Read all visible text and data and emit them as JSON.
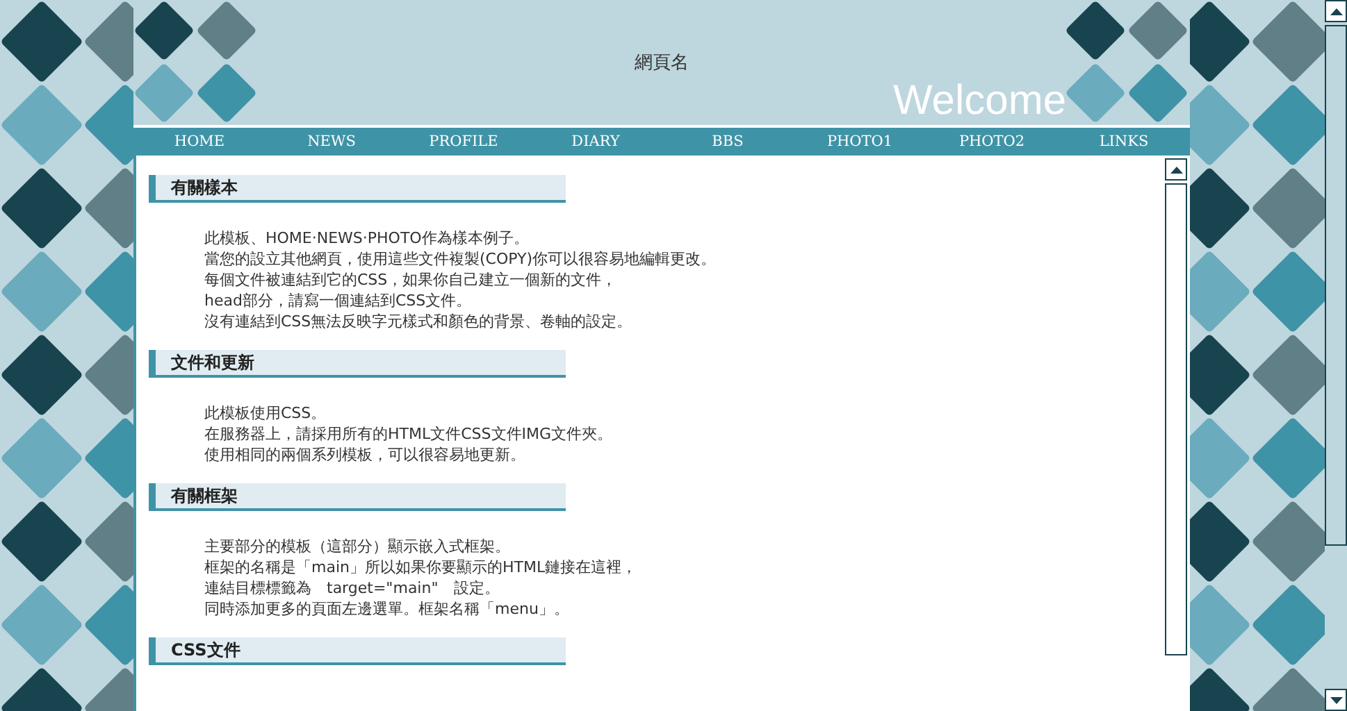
{
  "header": {
    "title": "網頁名",
    "welcome": "Welcome"
  },
  "nav": [
    {
      "label": "HOME"
    },
    {
      "label": "NEWS"
    },
    {
      "label": "PROFILE"
    },
    {
      "label": "DIARY"
    },
    {
      "label": "BBS"
    },
    {
      "label": "PHOTO1"
    },
    {
      "label": "PHOTO2"
    },
    {
      "label": "LINKS"
    }
  ],
  "sections": [
    {
      "heading": "有關樣本",
      "lines": [
        "此模板、HOME‧NEWS‧PHOTO作為樣本例子。",
        "當您的設立其他網頁，使用這些文件複製(COPY)你可以很容易地編輯更改。",
        "每個文件被連結到它的CSS，如果你自己建立一個新的文件，",
        "head部分，請寫一個連結到CSS文件。",
        "沒有連結到CSS無法反映字元樣式和顏色的背景、卷軸的設定。"
      ]
    },
    {
      "heading": "文件和更新",
      "lines": [
        "此模板使用CSS。",
        "在服務器上，請採用所有的HTML文件CSS文件IMG文件夾。",
        "使用相同的兩個系列模板，可以很容易地更新。"
      ]
    },
    {
      "heading": "有關框架",
      "lines": [
        "主要部分的模板（這部分）顯示嵌入式框架。",
        "框架的名稱是「main」所以如果你要顯示的HTML鏈接在這裡，",
        "連結目標標籤為　target=\"main\"　設定。",
        "同時添加更多的頁面左邊選單。框架名稱「menu」。"
      ]
    },
    {
      "heading": "CSS文件"
    }
  ]
}
